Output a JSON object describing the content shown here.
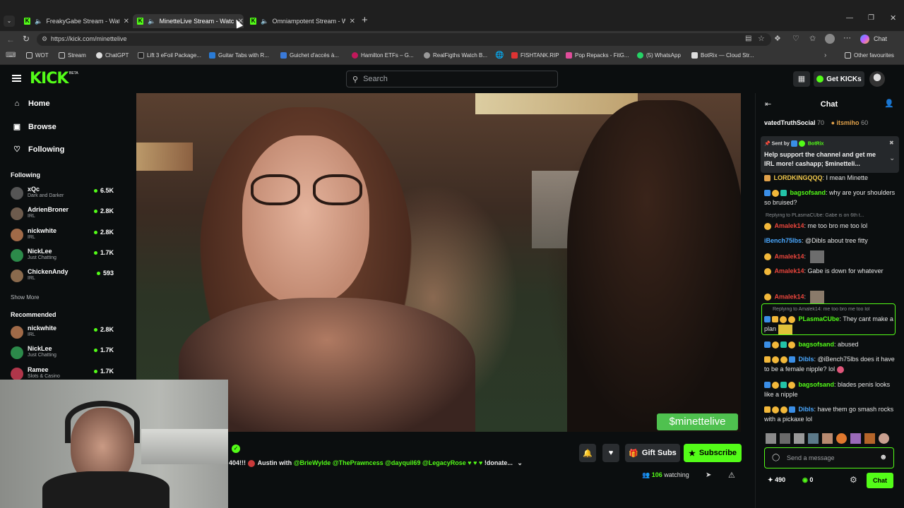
{
  "browser": {
    "tabs": [
      {
        "title": "FreakyGabe Stream - Watch L",
        "active": false
      },
      {
        "title": "MinetteLive Stream - Watch L",
        "active": true
      },
      {
        "title": "Omniampotent Stream - Watc",
        "active": false
      }
    ],
    "url": "https://kick.com/minettelive",
    "copilot_label": "Chat",
    "bookmarks": [
      "WOT",
      "Stream",
      "ChatGPT",
      "Lift 3 eFoil Package...",
      "Guitar Tabs with R...",
      "Guichet d'accès à...",
      "Hamilton ETFs – G...",
      "RealFigths Watch B...",
      "FISHTANK.RIP",
      "Pop Repacks - FitG...",
      "(5) WhatsApp",
      "BotRix — Cloud Str..."
    ],
    "other_favourites": "Other favourites"
  },
  "kick": {
    "logo": "KICK",
    "logo_beta": "BETA",
    "search_placeholder": "Search",
    "get_kicks": "Get KICKs"
  },
  "sidebar": {
    "nav": [
      {
        "label": "Home",
        "icon": "home-icon"
      },
      {
        "label": "Browse",
        "icon": "browse-icon"
      },
      {
        "label": "Following",
        "icon": "heart-icon"
      }
    ],
    "following_heading": "Following",
    "following": [
      {
        "name": "xQc",
        "category": "Dark and Darker",
        "viewers": "6.5K"
      },
      {
        "name": "AdrienBroner",
        "category": "IRL",
        "viewers": "2.8K"
      },
      {
        "name": "nickwhite",
        "category": "IRL",
        "viewers": "2.8K"
      },
      {
        "name": "NickLee",
        "category": "Just Chatting",
        "viewers": "1.7K"
      },
      {
        "name": "ChickenAndy",
        "category": "IRL",
        "viewers": "593"
      }
    ],
    "show_more": "Show More",
    "recommended_heading": "Recommended",
    "recommended": [
      {
        "name": "nickwhite",
        "category": "IRL",
        "viewers": "2.8K"
      },
      {
        "name": "NickLee",
        "category": "Just Chatting",
        "viewers": "1.7K"
      },
      {
        "name": "Ramee",
        "category": "Slots & Casino",
        "viewers": "1.7K"
      }
    ]
  },
  "video": {
    "overlay_tag": "$minettelive"
  },
  "stream_info": {
    "title_prefix": "404!!! ",
    "title_main": " Austin with ",
    "mentions": [
      "@BrieWylde",
      "@ThePrawncess",
      "@dayquil69",
      "@LegacyRose"
    ],
    "title_suffix": " !donate...",
    "gift_subs": "Gift Subs",
    "subscribe": "Subscribe",
    "watching_count": "106",
    "watching_label": "watching"
  },
  "chat": {
    "header": "Chat",
    "gifters": [
      {
        "name": "vatedTruthSocial",
        "count": "70"
      },
      {
        "name": "itsmiho",
        "count": "60"
      }
    ],
    "pinned": {
      "sent_by": "Sent by",
      "bot_name": "BotRix",
      "text": "Help support the channel and get me IRL more! cashapp; $minetteli..."
    },
    "messages": [
      {
        "user": "LORDKINGQQQ",
        "color": "#f2c94c",
        "text": ": I mean Minette"
      },
      {
        "user": "bagsofsand",
        "color": "#53fc18",
        "text": ": why are your shoulders so bruised?"
      },
      {
        "reply": "Replying to PLasmaCUbe: Gabe is on 6th t..."
      },
      {
        "user": "Amalek14",
        "color": "#e8453c",
        "text": ": me too bro me too lol"
      },
      {
        "user": "iBench75lbs",
        "color": "#4aa8ff",
        "text": ": @Dibls about tree fitty"
      },
      {
        "user": "Amalek14",
        "color": "#e8453c",
        "text": ":"
      },
      {
        "user": "Amalek14",
        "color": "#e8453c",
        "text": ": Gabe is down for whatever"
      },
      {
        "user": "Amalek14",
        "color": "#e8453c",
        "text": ":"
      },
      {
        "reply": "Replying to Amalek14: me too bro me too lol"
      },
      {
        "user": "PLasmaCUbe",
        "color": "#53fc18",
        "text": ": They cant make a plan"
      },
      {
        "user": "bagsofsand",
        "color": "#53fc18",
        "text": ": abused"
      },
      {
        "user": "Dibls",
        "color": "#4aa8ff",
        "text": ": @iBench75lbs does it have to be a female nipple? lol"
      },
      {
        "user": "bagsofsand",
        "color": "#53fc18",
        "text": ": blades penis looks like a nipple"
      },
      {
        "user": "Dibls",
        "color": "#4aa8ff",
        "text": ": have them go smash rocks with a pickaxe lol"
      }
    ],
    "input_placeholder": "Send a message",
    "points": "490",
    "kicks": "0",
    "send_label": "Chat"
  },
  "colors": {
    "accent": "#53fc18",
    "bg": "#0b0e0f",
    "tag_green": "#4fc14f"
  }
}
